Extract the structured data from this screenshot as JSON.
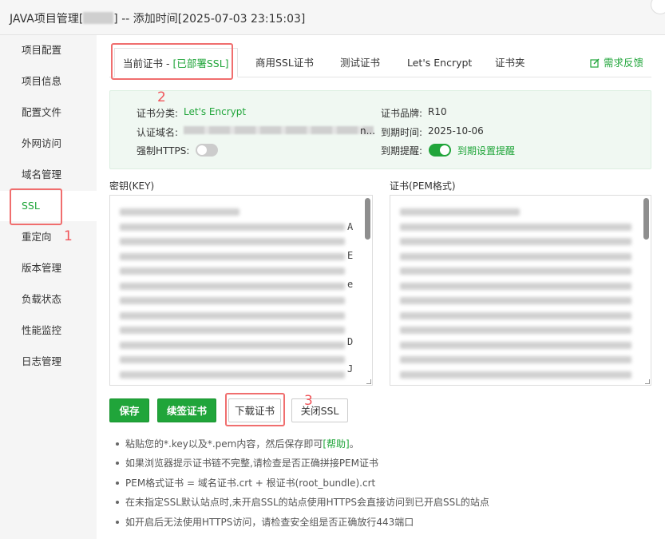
{
  "window": {
    "title_prefix": "JAVA项目管理[",
    "title_suffix": "] -- 添加时间[2025-07-03 23:15:03]"
  },
  "sidebar": {
    "items": [
      {
        "label": "项目配置"
      },
      {
        "label": "项目信息"
      },
      {
        "label": "配置文件"
      },
      {
        "label": "外网访问"
      },
      {
        "label": "域名管理"
      },
      {
        "label": "SSL",
        "active": true
      },
      {
        "label": "重定向"
      },
      {
        "label": "版本管理"
      },
      {
        "label": "负载状态"
      },
      {
        "label": "性能监控"
      },
      {
        "label": "日志管理"
      }
    ]
  },
  "tabs": {
    "current_label": "当前证书 - ",
    "current_status": "[已部署SSL]",
    "items": [
      "商用SSL证书",
      "测试证书",
      "Let's Encrypt",
      "证书夹"
    ],
    "feedback": "需求反馈"
  },
  "cert_info": {
    "category_label": "证书分类:",
    "category_value": "Let's Encrypt",
    "brand_label": "证书品牌:",
    "brand_value": "R10",
    "domain_label": "认证域名:",
    "domain_tail": "n...",
    "expire_label": "到期时间:",
    "expire_value": "2025-10-06",
    "https_label": "强制HTTPS:",
    "https_on": false,
    "remind_label": "到期提醒:",
    "remind_on": true,
    "remind_link": "到期设置提醒"
  },
  "key_area": {
    "label": "密钥(KEY)",
    "visible_chars": [
      "A",
      "E",
      "e",
      "D",
      "J"
    ]
  },
  "cert_area": {
    "label": "证书(PEM格式)"
  },
  "buttons": {
    "save": "保存",
    "renew": "续签证书",
    "download": "下载证书",
    "close_ssl": "关闭SSL"
  },
  "tips": {
    "tip1_text": "粘贴您的*.key以及*.pem内容，然后保存即可",
    "tip1_help": "[帮助]",
    "tip1_end": "。",
    "tip2": "如果浏览器提示证书链不完整,请检查是否正确拼接PEM证书",
    "tip3": "PEM格式证书 = 域名证书.crt + 根证书(root_bundle).crt",
    "tip4": "在未指定SSL默认站点时,未开启SSL的站点使用HTTPS会直接访问到已开启SSL的站点",
    "tip5": "如开启后无法使用HTTPS访问，请检查安全组是否正确放行443端口"
  },
  "annotations": {
    "marker1": "1",
    "marker2": "2",
    "marker3": "3"
  },
  "colors": {
    "accent": "#20a53a",
    "annotation": "#f06e6e"
  }
}
